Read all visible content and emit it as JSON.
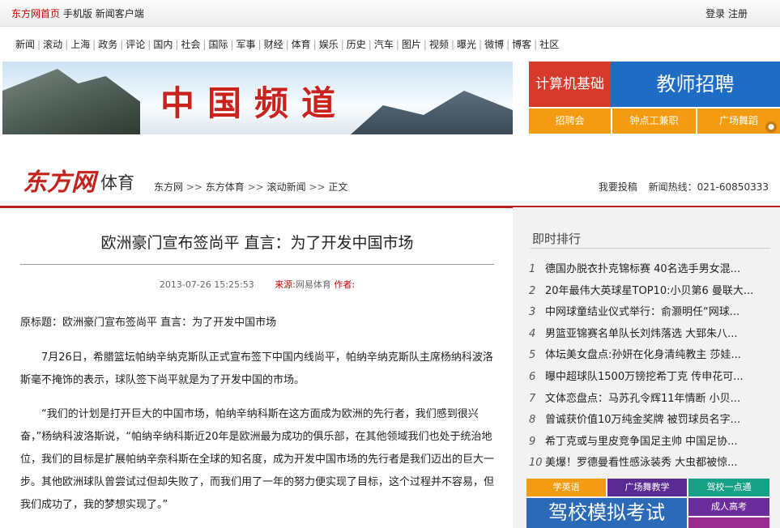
{
  "topbar": {
    "home": "东方网首页",
    "mobile": "手机版",
    "client": "新闻客户端",
    "login": "登录",
    "register": "注册"
  },
  "nav": [
    "新闻",
    "滚动",
    "上海",
    "政务",
    "评论",
    "国内",
    "社会",
    "国际",
    "军事",
    "财经",
    "体育",
    "娱乐",
    "历史",
    "汽车",
    "图片",
    "视频",
    "曝光",
    "微博",
    "博客",
    "社区"
  ],
  "banner": {
    "title": "中国频道"
  },
  "ads": {
    "ad1": "计算机基础",
    "ad2": "教师招聘",
    "ad3": "招聘会",
    "ad4": "钟点工兼职",
    "ad5": "广场舞蹈"
  },
  "section": {
    "logo": "东方网",
    "name": "体育",
    "breadcrumb": [
      "东方网",
      "东方体育",
      "滚动新闻",
      "正文"
    ],
    "breadcrumb_sep": ">>",
    "submit": "我要投稿",
    "hotline": "新闻热线：021-60850333"
  },
  "article": {
    "title": "欧洲豪门宣布签尚平  直言：为了开发中国市场",
    "date": "2013-07-26 15:25:53",
    "source_label": "来源:",
    "source": "网易体育",
    "author_label": "作者:",
    "original_title": "原标题：欧洲豪门宣布签尚平 直言：为了开发中国市场",
    "paragraphs": [
      "7月26日，希腊篮坛帕纳辛纳克斯队正式宣布签下中国内线尚平，帕纳辛纳克斯队主席杨纳科波洛斯毫不掩饰的表示，球队签下尚平就是为了开发中国的市场。",
      "“我们的计划是打开巨大的中国市场，帕纳辛纳科斯在这方面成为欧洲的先行者，我们感到很兴奋，”杨纳科波洛斯说，“帕纳辛纳科斯近20年是欧洲最为成功的俱乐部，在其他领域我们也处于统治地位，我们的目标是扩展帕纳辛奈科斯在全球的知名度，成为开发中国市场的先行者是我们迈出的巨大一步。其他欧洲球队曾尝试过但却失败了，而我们用了一年的努力便实现了目标，这个过程并不容易，但我们成功了，我的梦想实现了。”"
    ]
  },
  "sidebar": {
    "heading": "即时排行",
    "items": [
      {
        "num": "1",
        "text": "德国办脱衣扑克锦标赛 40名选手男女混..."
      },
      {
        "num": "2",
        "text": "20年最伟大英球星TOP10:小贝第6 曼联大..."
      },
      {
        "num": "3",
        "text": "中网球童结业仪式举行：俞灏明任“网球..."
      },
      {
        "num": "4",
        "text": "男篮亚锦赛名单队长刘炜落选 大郅朱八..."
      },
      {
        "num": "5",
        "text": "体坛美女盘点:孙妍在化身清纯教主 莎娃..."
      },
      {
        "num": "6",
        "text": "曝中超球队1500万镑挖希丁克 传申花可..."
      },
      {
        "num": "7",
        "text": "文体恋盘点：马苏孔令辉11年情断 小贝..."
      },
      {
        "num": "8",
        "text": "曾诚获价值10万纯金奖牌 被罚球员名字..."
      },
      {
        "num": "9",
        "text": "希丁克或与里皮竞争国足主帅 中国足协..."
      },
      {
        "num": "10",
        "text": "美爆！罗德曼看性感泳装秀 大虫都被惊..."
      }
    ]
  },
  "bottom_ads": {
    "b1": "学英语",
    "b2": "广场舞教学",
    "b3": "驾校一点通",
    "b4": "驾校模拟考试",
    "b5": "成人高考"
  }
}
